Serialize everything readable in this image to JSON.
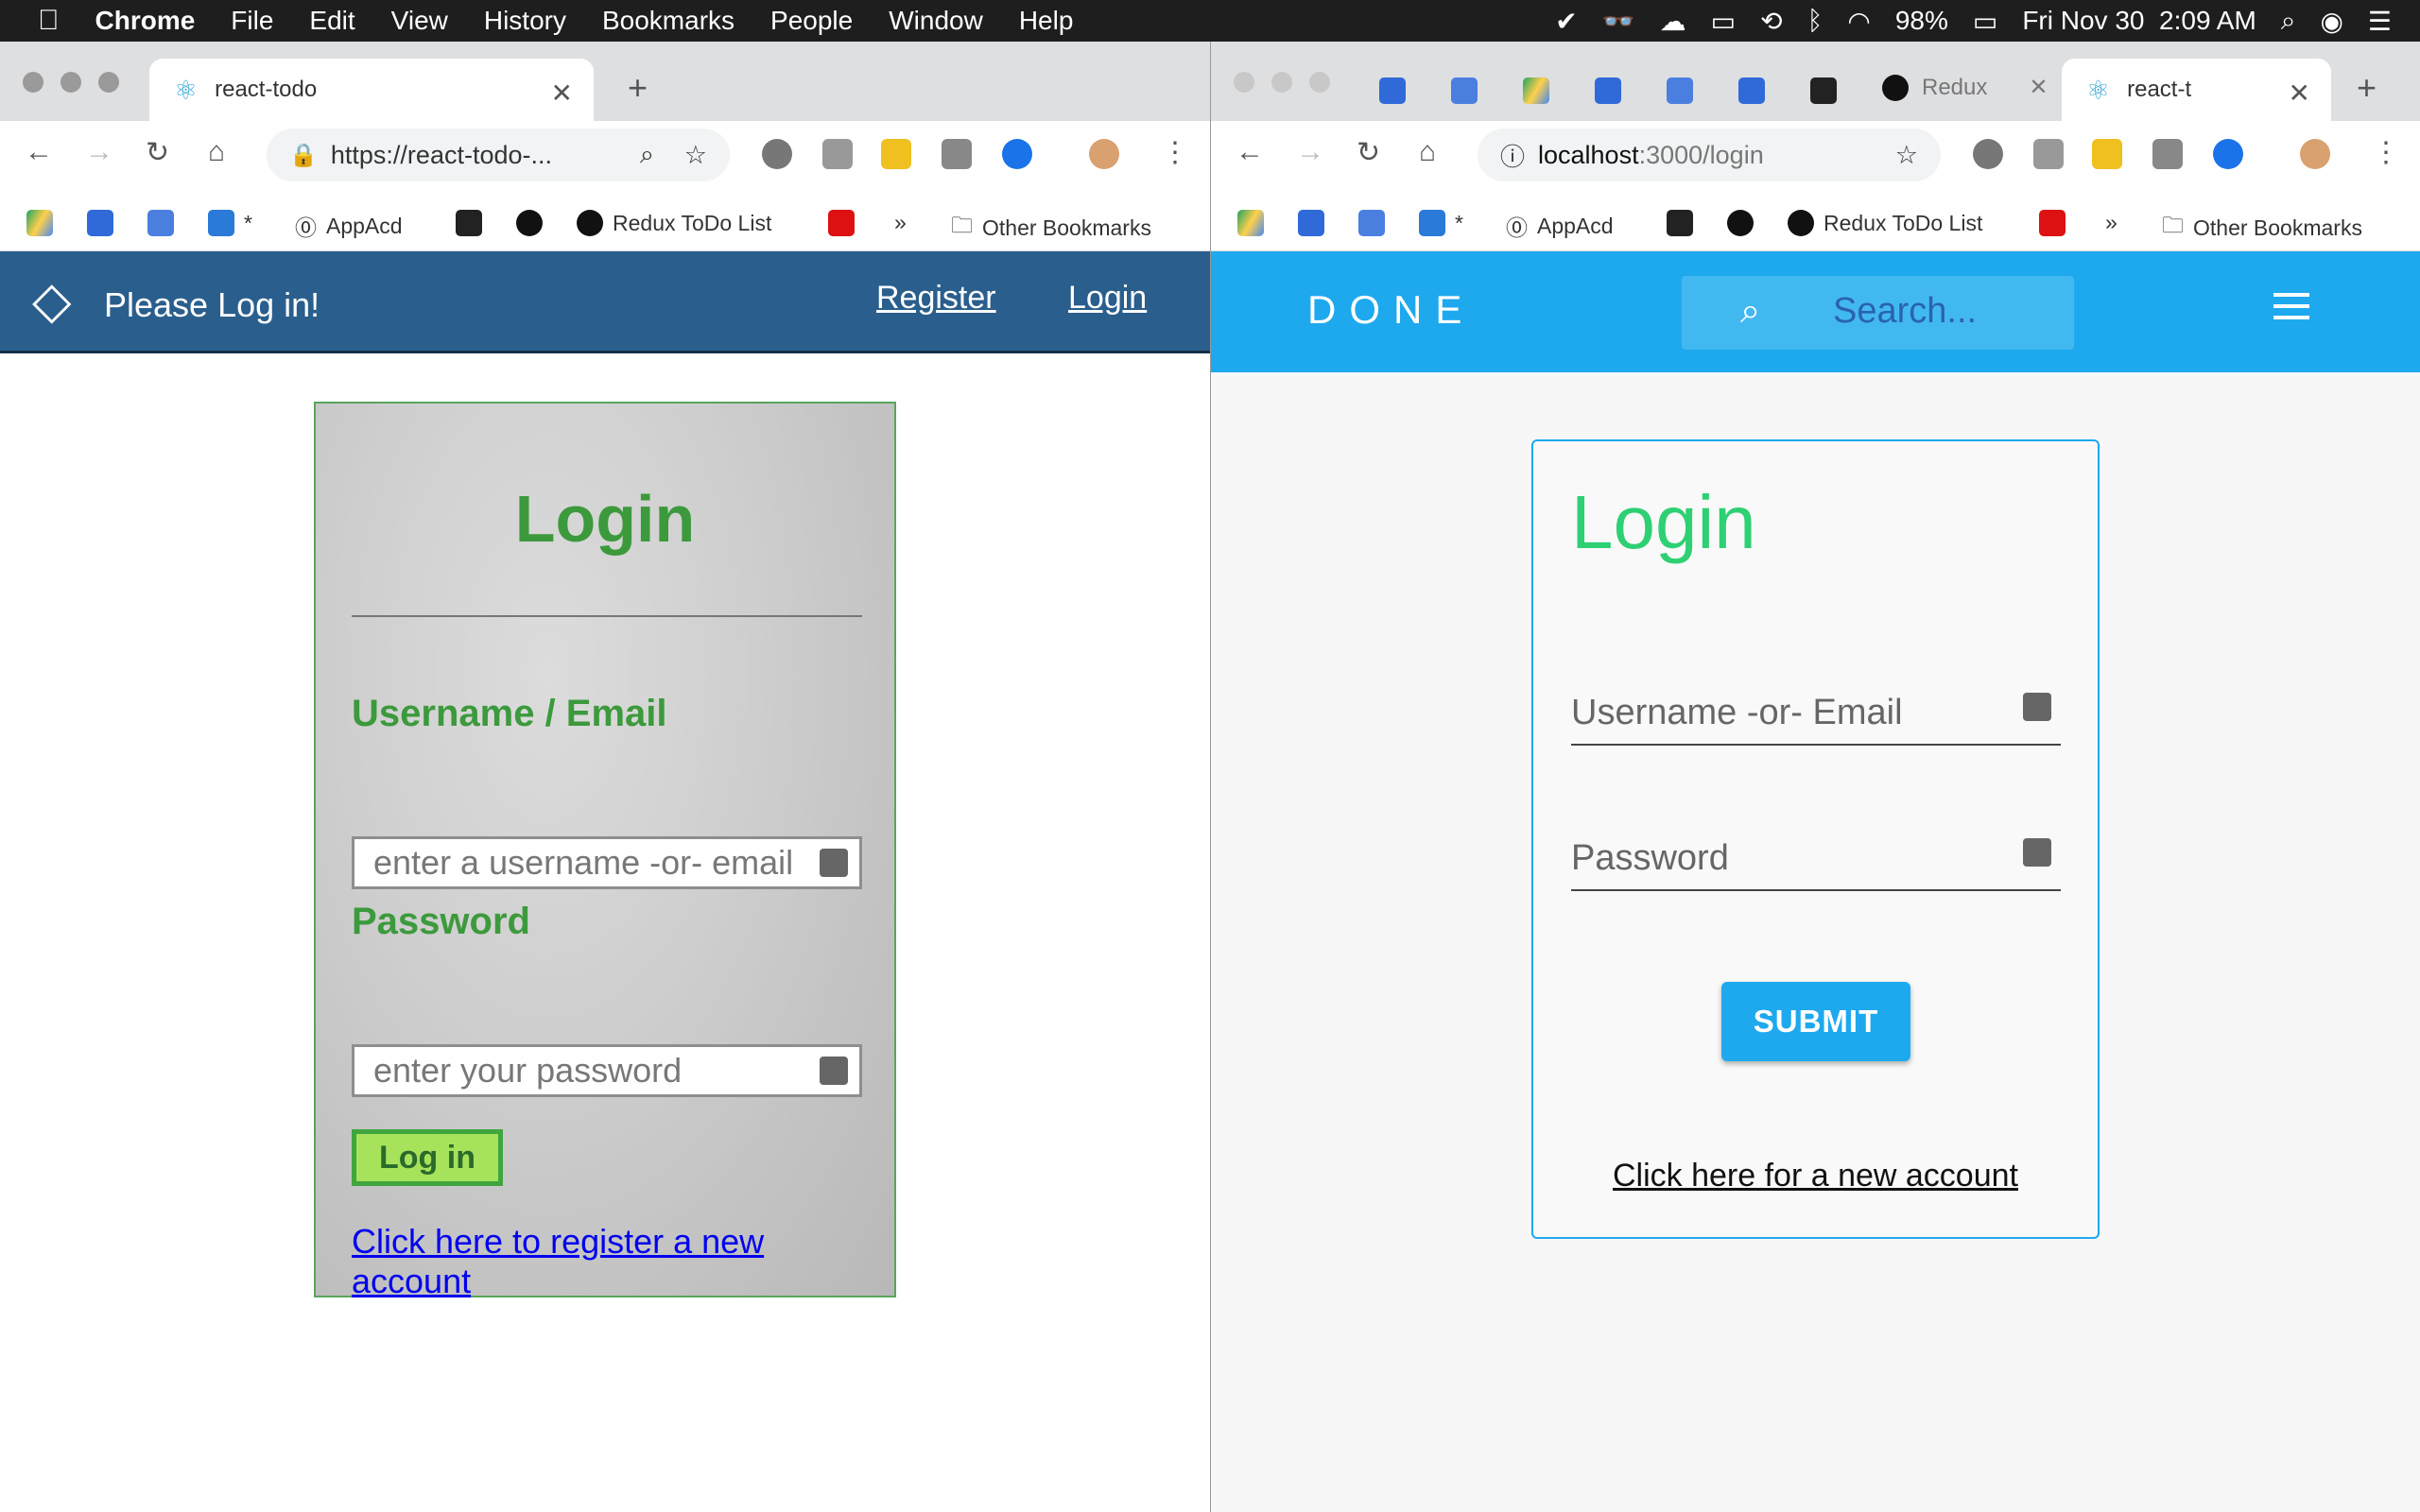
{
  "menubar": {
    "app": "Chrome",
    "items": [
      "File",
      "Edit",
      "View",
      "History",
      "Bookmarks",
      "People",
      "Window",
      "Help"
    ],
    "battery": "98%",
    "clock": "Fri Nov 30  2:09 AM"
  },
  "left": {
    "tab_title": "react-todo",
    "url": "https://react-todo-...",
    "bookmarks": {
      "star": "*",
      "appacd": "AppAcd",
      "redux": "Redux ToDo List",
      "more": "»",
      "other": "Other Bookmarks"
    },
    "header": {
      "brand": "Please Log in!",
      "register": "Register",
      "login": "Login"
    },
    "form": {
      "title": "Login",
      "username_label": "Username / Email",
      "username_placeholder": "enter a username -or- email",
      "password_label": "Password",
      "password_placeholder": "enter your password",
      "button": "Log in",
      "register_link": "Click here to register a new account"
    }
  },
  "right": {
    "tab_partial": "Redux",
    "tab_title": "react-t",
    "url_host": "localhost",
    "url_rest": ":3000/login",
    "bookmarks": {
      "star": "*",
      "appacd": "AppAcd",
      "redux": "Redux ToDo List",
      "more": "»",
      "other": "Other Bookmarks"
    },
    "header": {
      "logo": "DONE",
      "search_placeholder": "Search..."
    },
    "form": {
      "title": "Login",
      "username_placeholder": "Username -or- Email",
      "password_placeholder": "Password",
      "submit": "SUBMIT",
      "register_link": "Click here for a new account"
    }
  },
  "colors": {
    "left_header": "#2a5e8c",
    "left_accent": "#3c9a3c",
    "right_header": "#1ea9ee",
    "right_title": "#2ed073"
  }
}
